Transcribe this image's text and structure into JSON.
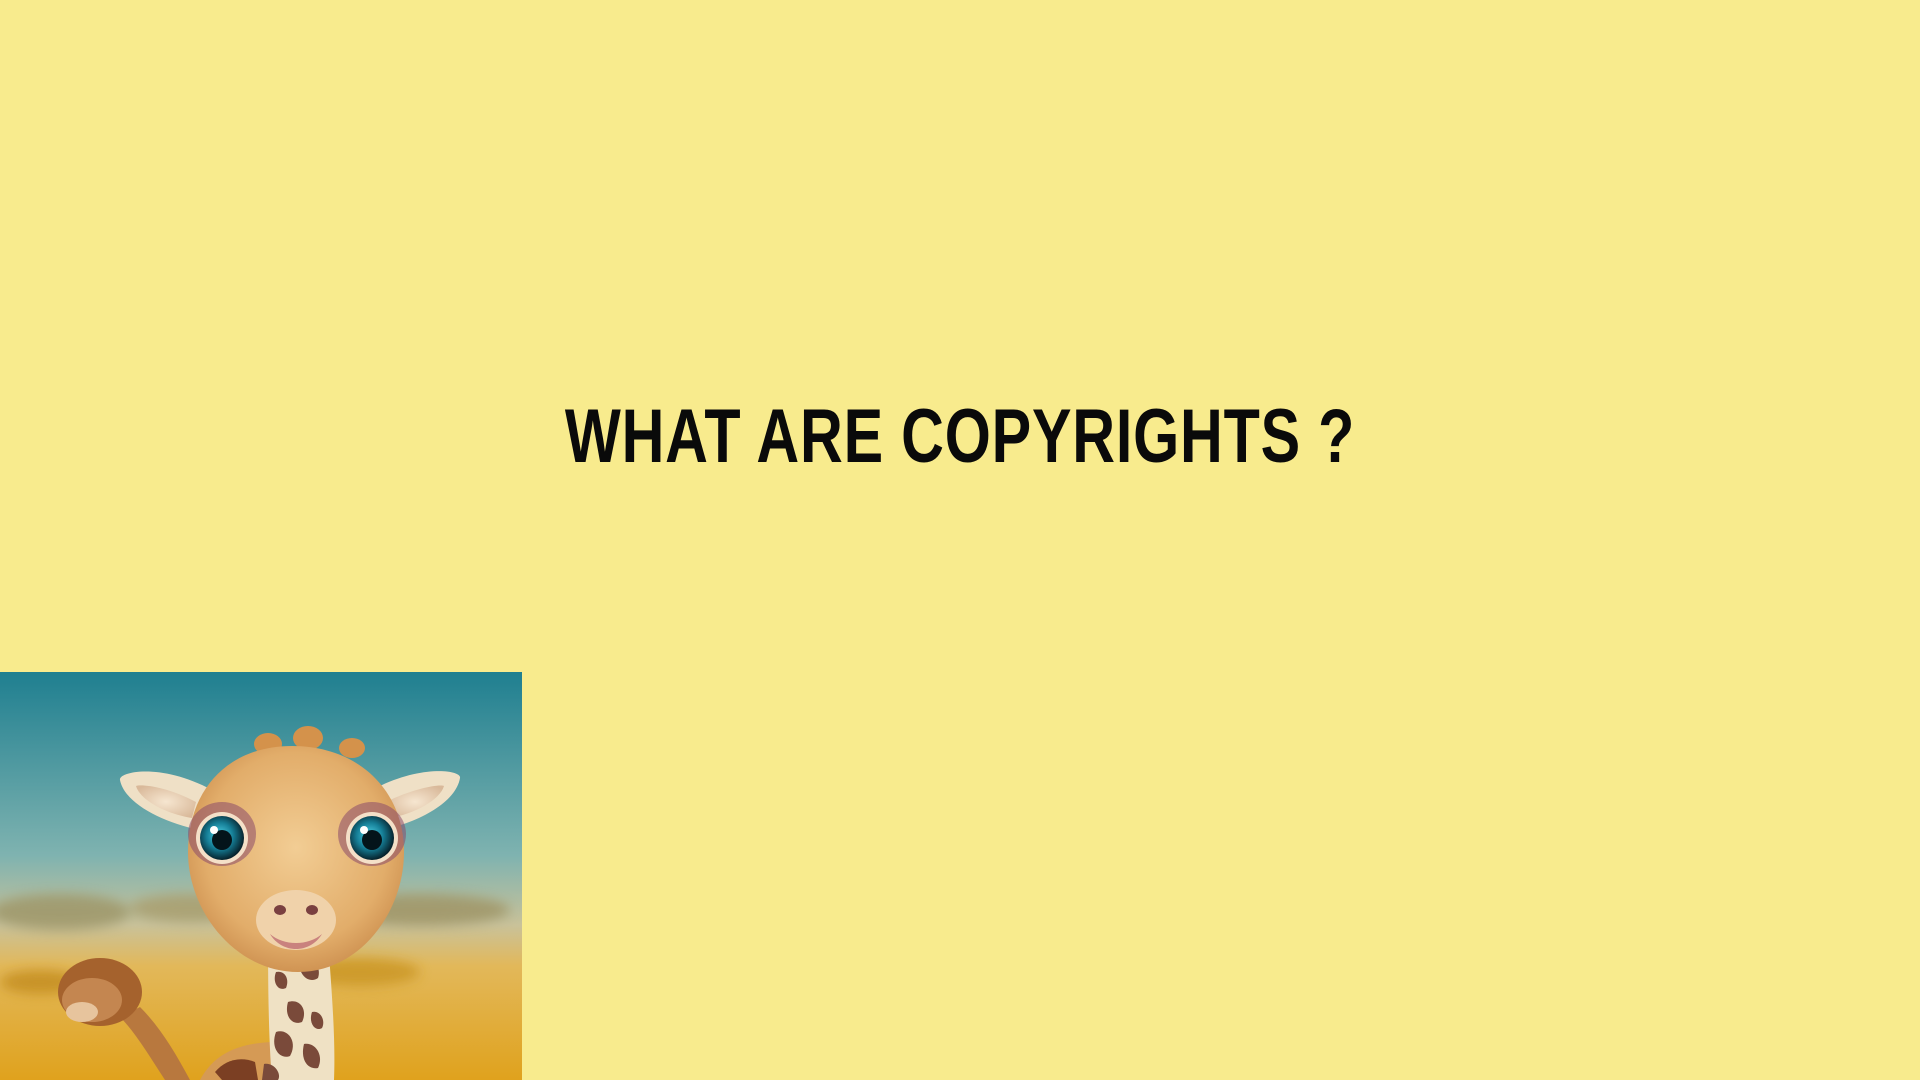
{
  "slide": {
    "title": "WHAT ARE COPYRIGHTS ?",
    "background_color": "#f8eb8d",
    "text_color": "#0a0a0a"
  },
  "image": {
    "subject": "cartoon baby giraffe",
    "icon": "giraffe-illustration"
  }
}
